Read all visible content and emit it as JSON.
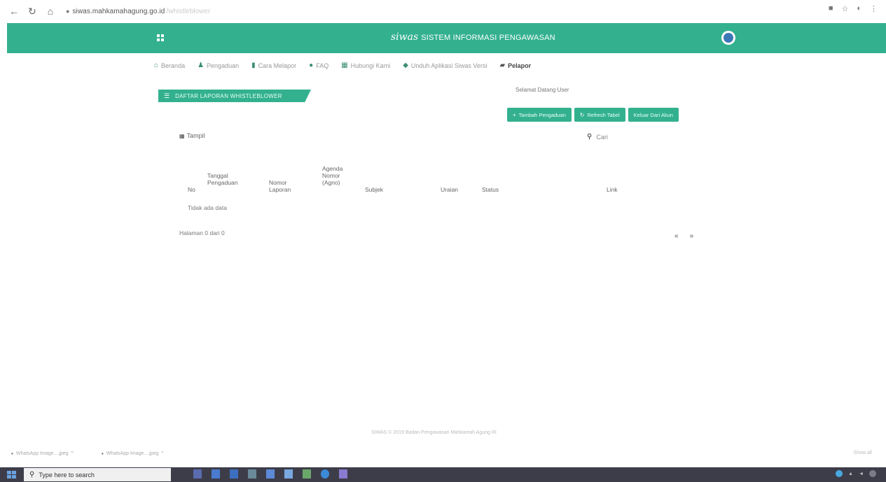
{
  "browser": {
    "url": "siwas.mahkamahagung.go.id",
    "url_path": "/whistleblower"
  },
  "header": {
    "logo": "siwas",
    "title": "SISTEM INFORMASI PENGAWASAN"
  },
  "nav": {
    "items": [
      {
        "label": "Beranda"
      },
      {
        "label": "Pengaduan"
      },
      {
        "label": "Cara Melapor"
      },
      {
        "label": "FAQ"
      },
      {
        "label": "Hubungi Kami"
      },
      {
        "label": "Unduh Aplikasi Siwas Versi"
      },
      {
        "label": "Pelapor"
      }
    ]
  },
  "panel": {
    "title": "DAFTAR LAPORAN WHISTLEBLOWER",
    "welcome": "Selamat Datang User",
    "buttons": {
      "add": "Tambah Pengaduan",
      "refresh": "Refresh Tabel",
      "logout": "Keluar Dari Akun"
    },
    "tampil": "Tampil",
    "search": "Cari"
  },
  "table": {
    "headers": {
      "no": "No",
      "tanggal": "Tanggal Pengaduan",
      "nomor": "Nomor Laporan",
      "agenda": "Agenda Nomor (Agno)",
      "subjek": "Subjek",
      "uraian": "Uraian",
      "status": "Status",
      "link": "Link"
    },
    "empty": "Tidak ada data",
    "info": "Halaman 0 dari 0",
    "prev": "«",
    "next": "»"
  },
  "footer": {
    "text": "SIWAS © 2019 Badan Pengawasan Mahkamah Agung RI"
  },
  "downloads": [
    {
      "label": "WhatsApp Image....jpeg"
    },
    {
      "label": "WhatsApp Image....jpeg"
    }
  ],
  "downloads_show_all": "Show all",
  "taskbar": {
    "search_placeholder": "Type here to search"
  },
  "colors": {
    "brand": "#33b18f",
    "taskbar": "#3d3d4a"
  }
}
